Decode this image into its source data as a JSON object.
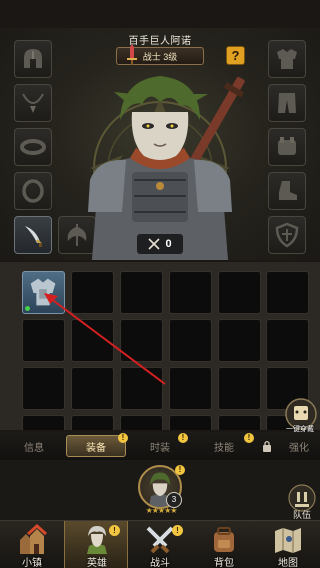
{
  "character": {
    "name": "百手巨人阿诺",
    "class_level": "战士 3级",
    "help_label": "?",
    "power_value": "0"
  },
  "equipment_slots": [
    "helmet-icon",
    "necklace-icon",
    "bracer-icon",
    "ring-icon",
    "dagger-icon",
    "axe-weapon-icon",
    "chest-armor-icon",
    "pants-icon",
    "gauntlet-icon",
    "boot-icon",
    "shield-icon"
  ],
  "inventory": {
    "one_click_label": "一键穿戴"
  },
  "tabs": [
    {
      "label": "信息",
      "active": false
    },
    {
      "label": "装备",
      "active": true
    },
    {
      "label": "时装",
      "active": false
    },
    {
      "label": "技能",
      "active": false
    },
    {
      "label": "强化",
      "active": false
    }
  ],
  "badges": {
    "alert": "!"
  },
  "hero_portrait": {
    "level": "3"
  },
  "team_label": "队伍",
  "bottom_nav": [
    {
      "label": "小镇"
    },
    {
      "label": "英雄"
    },
    {
      "label": "战斗"
    },
    {
      "label": "背包"
    },
    {
      "label": "地图"
    }
  ],
  "colors": {
    "accent_gold": "#e0a021",
    "badge_yellow": "#f2c640",
    "annotation_arrow": "#d42020"
  }
}
